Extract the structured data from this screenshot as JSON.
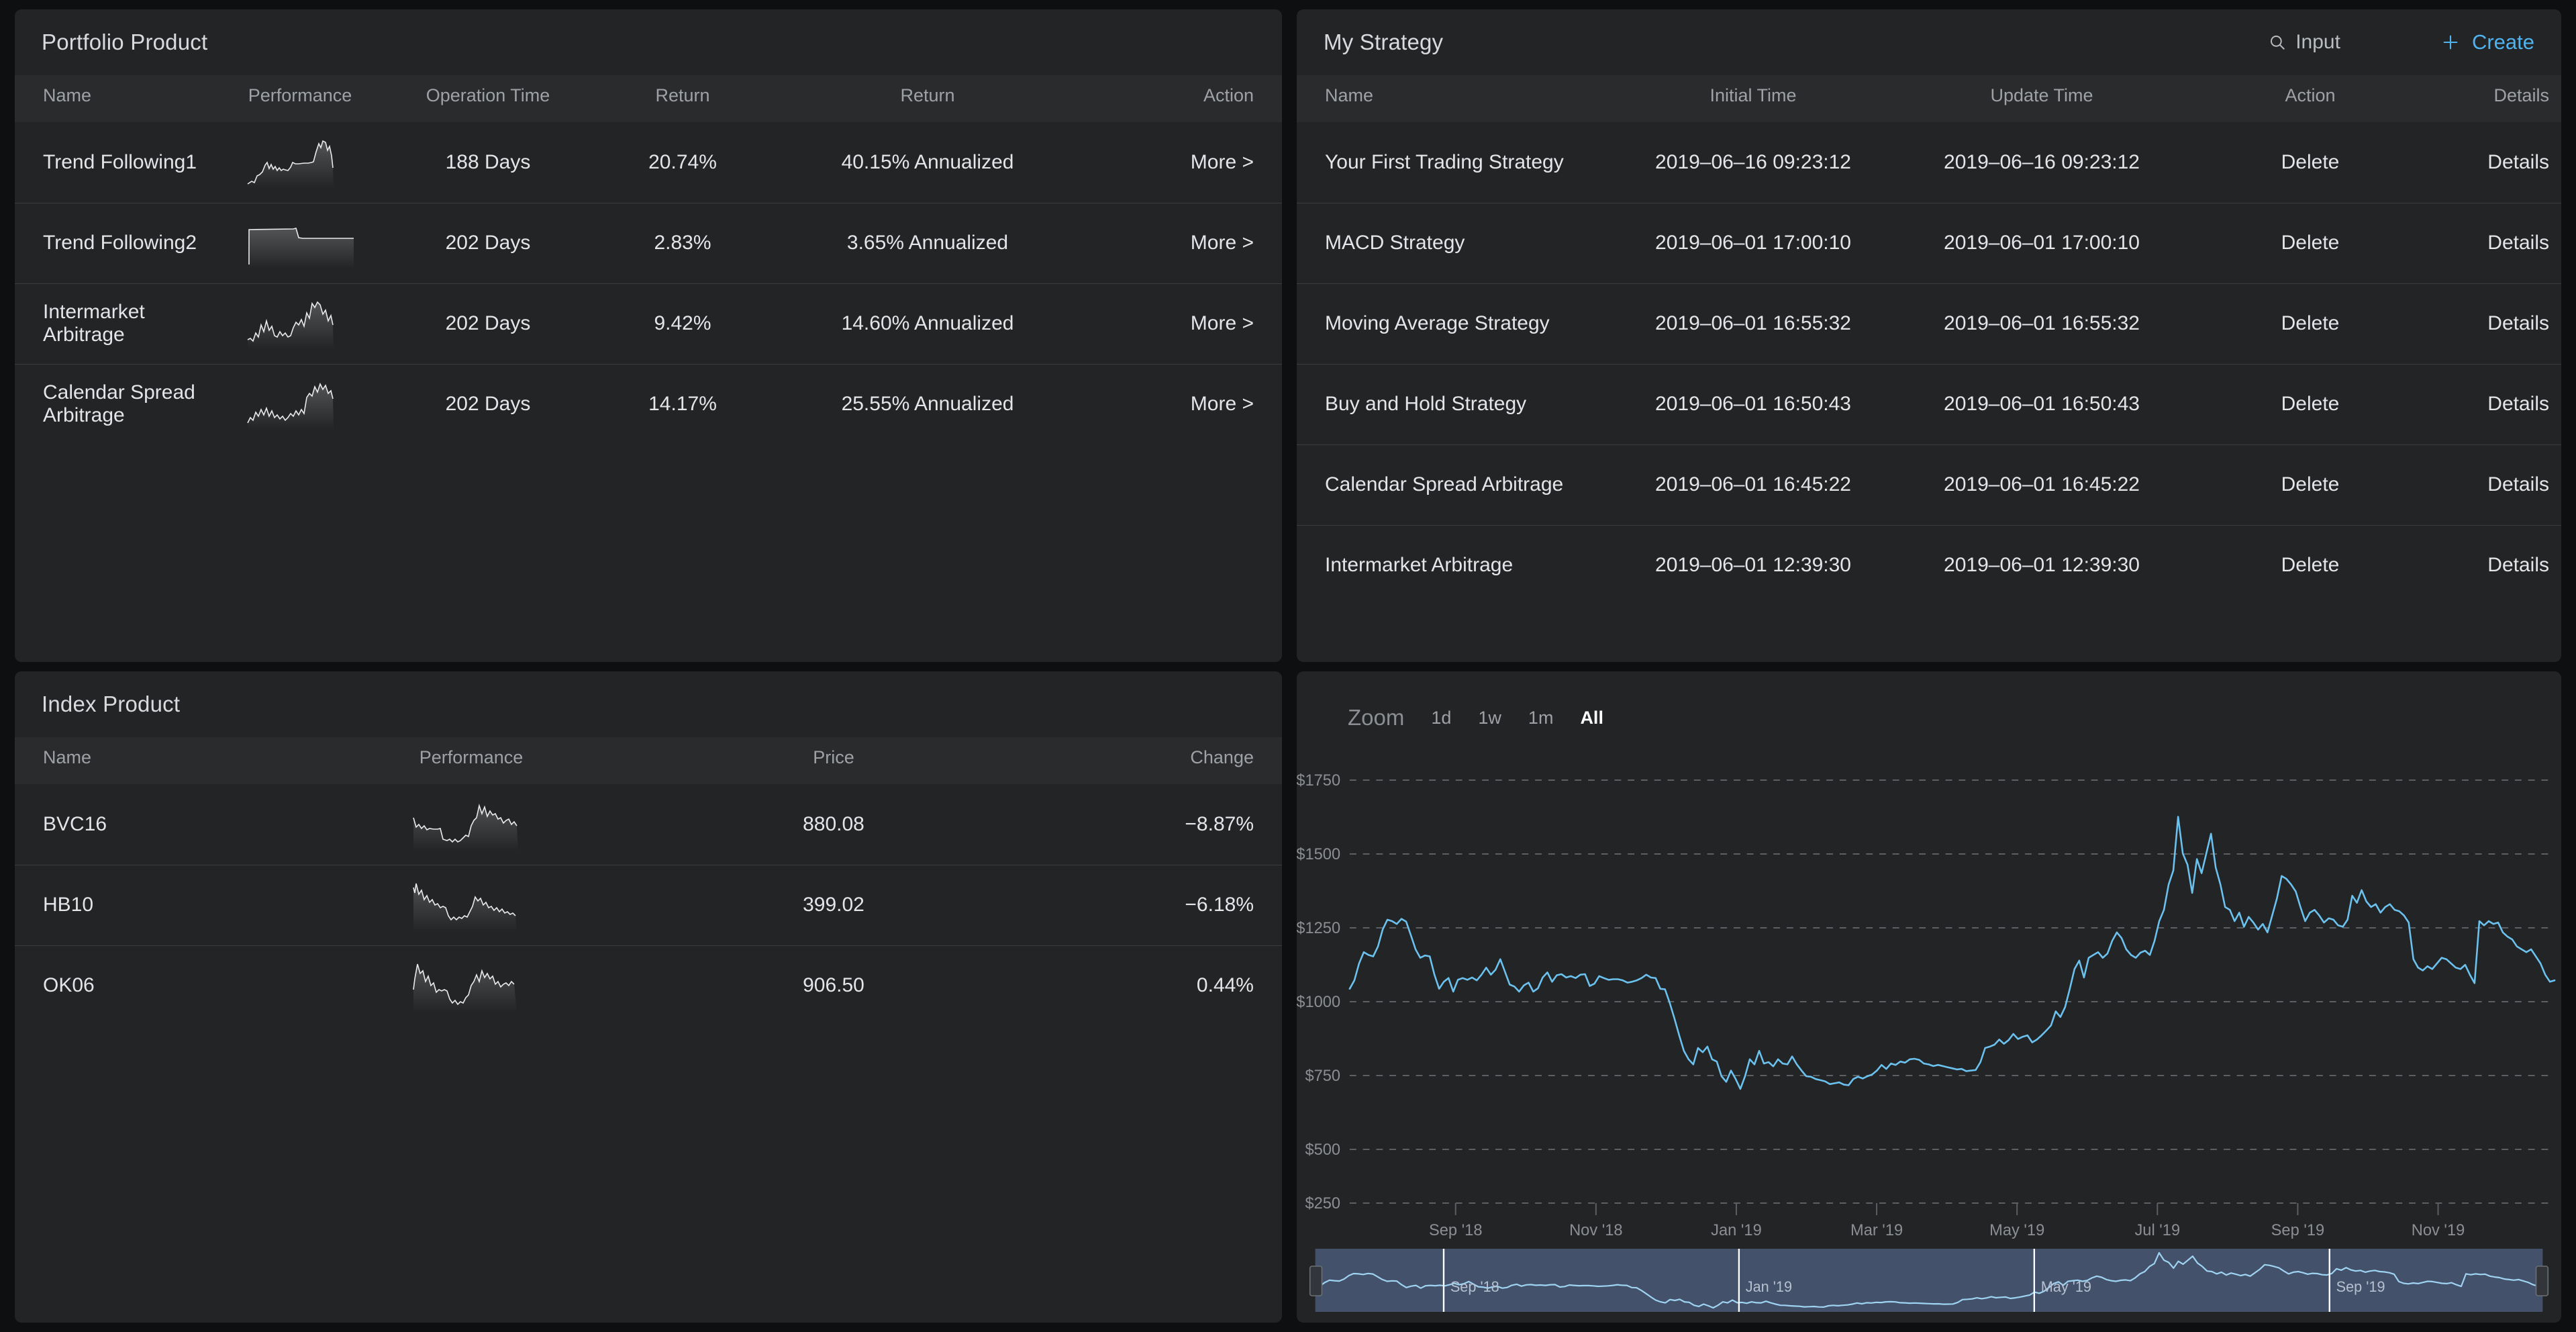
{
  "portfolio": {
    "title": "Portfolio Product",
    "columns": [
      "Name",
      "Performance",
      "Operation Time",
      "Return",
      "Return",
      "Action"
    ],
    "rows": [
      {
        "name": "Trend Following1",
        "operation_time": "188 Days",
        "return": "20.74%",
        "annualized": "40.15% Annualized",
        "action": "More >"
      },
      {
        "name": "Trend Following2",
        "operation_time": "202 Days",
        "return": "2.83%",
        "annualized": "3.65% Annualized",
        "action": "More >"
      },
      {
        "name": "Intermarket Arbitrage",
        "operation_time": "202 Days",
        "return": "9.42%",
        "annualized": "14.60% Annualized",
        "action": "More >"
      },
      {
        "name": "Calendar Spread Arbitrage",
        "operation_time": "202 Days",
        "return": "14.17%",
        "annualized": "25.55% Annualized",
        "action": "More >"
      }
    ]
  },
  "strategy": {
    "title": "My Strategy",
    "search_placeholder": "Input",
    "search_icon": "search-icon",
    "create_label": "Create",
    "create_icon": "plus-icon",
    "columns": [
      "Name",
      "Initial Time",
      "Update Time",
      "Action",
      "Details"
    ],
    "rows": [
      {
        "name": "Your First Trading Strategy",
        "initial_time": "2019–06–16 09:23:12",
        "update_time": "2019–06–16 09:23:12",
        "action": "Delete",
        "details": "Details"
      },
      {
        "name": "MACD Strategy",
        "initial_time": "2019–06–01 17:00:10",
        "update_time": "2019–06–01 17:00:10",
        "action": "Delete",
        "details": "Details"
      },
      {
        "name": "Moving Average Strategy",
        "initial_time": "2019–06–01 16:55:32",
        "update_time": "2019–06–01 16:55:32",
        "action": "Delete",
        "details": "Details"
      },
      {
        "name": "Buy and Hold Strategy",
        "initial_time": "2019–06–01 16:50:43",
        "update_time": "2019–06–01 16:50:43",
        "action": "Delete",
        "details": "Details"
      },
      {
        "name": "Calendar Spread Arbitrage",
        "initial_time": "2019–06–01 16:45:22",
        "update_time": "2019–06–01 16:45:22",
        "action": "Delete",
        "details": "Details"
      },
      {
        "name": "Intermarket Arbitrage",
        "initial_time": "2019–06–01 12:39:30",
        "update_time": "2019–06–01 12:39:30",
        "action": "Delete",
        "details": "Details"
      }
    ]
  },
  "index_product": {
    "title": "Index Product",
    "columns": [
      "Name",
      "Performance",
      "Price",
      "Change"
    ],
    "rows": [
      {
        "name": "BVC16",
        "price": "880.08",
        "change": "−8.87%",
        "change_dir": "down"
      },
      {
        "name": "HB10",
        "price": "399.02",
        "change": "−6.18%",
        "change_dir": "down"
      },
      {
        "name": "OK06",
        "price": "906.50",
        "change": "0.44%",
        "change_dir": "up"
      }
    ]
  },
  "colors": {
    "accent_blue": "#4fb3ef",
    "positive_green": "#41b87f",
    "negative_red": "#e4555f",
    "chart_line": "#6cc2ef",
    "panel_bg": "#232426",
    "page_bg": "#0e0f11",
    "navigator_mask": "#43516b"
  },
  "chart_data": {
    "type": "line",
    "title": "",
    "xlabel": "",
    "ylabel": "",
    "zoom_label": "Zoom",
    "zoom_options": [
      "1d",
      "1w",
      "1m",
      "All"
    ],
    "zoom_selected": "All",
    "grid": true,
    "legend": "none",
    "ylim": [
      250,
      1750
    ],
    "ytick_labels": [
      "$1750",
      "$1500",
      "$1250",
      "$1000",
      "$750",
      "$500",
      "$250"
    ],
    "ytick_values": [
      1750,
      1500,
      1250,
      1000,
      750,
      500,
      250
    ],
    "xtick_labels": [
      "Sep '18",
      "Nov '18",
      "Jan '19",
      "Mar '19",
      "May '19",
      "Jul '19",
      "Sep '19",
      "Nov '19"
    ],
    "navigator_xtick_labels": [
      "Sep '18",
      "Jan '19",
      "May '19",
      "Sep '19"
    ],
    "values": [
      1010,
      1040,
      1100,
      1140,
      1130,
      1125,
      1160,
      1220,
      1255,
      1250,
      1240,
      1258,
      1248,
      1200,
      1150,
      1120,
      1128,
      1125,
      1060,
      1010,
      1035,
      1048,
      1000,
      1042,
      1048,
      1042,
      1050,
      1040,
      1060,
      1085,
      1060,
      1078,
      1115,
      1070,
      1025,
      1018,
      1000,
      1022,
      1032,
      1000,
      1012,
      1050,
      1068,
      1035,
      1058,
      1062,
      1050,
      1055,
      1048,
      1060,
      1062,
      1020,
      1028,
      1055,
      1048,
      1042,
      1044,
      1044,
      1040,
      1032,
      1035,
      1040,
      1048,
      1060,
      1050,
      1048,
      1010,
      1008,
      960,
      905,
      845,
      790,
      760,
      742,
      800,
      785,
      805,
      760,
      752,
      700,
      680,
      720,
      690,
      655,
      700,
      760,
      742,
      790,
      745,
      750,
      735,
      760,
      745,
      742,
      770,
      742,
      720,
      700,
      698,
      690,
      686,
      682,
      672,
      675,
      678,
      670,
      668,
      690,
      698,
      692,
      700,
      706,
      720,
      740,
      726,
      745,
      740,
      752,
      748,
      760,
      762,
      758,
      745,
      742,
      736,
      740,
      736,
      732,
      728,
      724,
      726,
      718,
      720,
      722,
      750,
      800,
      805,
      812,
      830,
      815,
      828,
      850,
      832,
      840,
      845,
      820,
      830,
      845,
      862,
      880,
      930,
      910,
      945,
      1010,
      1080,
      1110,
      1050,
      1120,
      1130,
      1140,
      1120,
      1135,
      1180,
      1210,
      1190,
      1150,
      1130,
      1120,
      1138,
      1145,
      1130,
      1180,
      1250,
      1290,
      1380,
      1430,
      1620,
      1490,
      1450,
      1350,
      1470,
      1420,
      1490,
      1560,
      1440,
      1380,
      1300,
      1290,
      1250,
      1280,
      1230,
      1265,
      1245,
      1220,
      1240,
      1210,
      1270,
      1330,
      1410,
      1400,
      1380,
      1355,
      1300,
      1250,
      1280,
      1290,
      1270,
      1245,
      1260,
      1255,
      1235,
      1230,
      1255,
      1340,
      1315,
      1360,
      1320,
      1300,
      1310,
      1280,
      1300,
      1310,
      1290,
      1285,
      1270,
      1245,
      1115,
      1085,
      1075,
      1090,
      1080,
      1100,
      1120,
      1115,
      1100,
      1085,
      1080,
      1095,
      1060,
      1030,
      1250,
      1235,
      1250,
      1240,
      1245,
      1210,
      1195,
      1185,
      1160,
      1150,
      1140,
      1150,
      1125,
      1100,
      1060,
      1035,
      1040
    ]
  }
}
